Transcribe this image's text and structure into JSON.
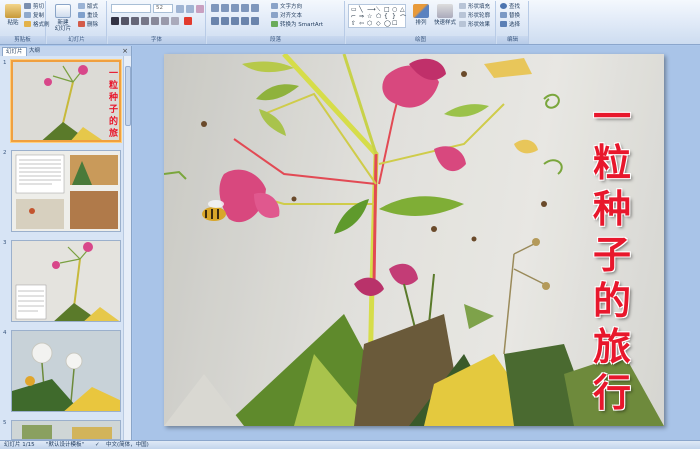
{
  "ribbon": {
    "clipboard": {
      "paste": "粘贴",
      "cut": "剪切",
      "copy": "复制",
      "format_painter": "格式刷",
      "group_label": "剪贴板"
    },
    "slides": {
      "new_slide": "新建\n幻灯片",
      "layout": "版式",
      "reset": "重设",
      "delete": "删除",
      "group_label": "幻灯片"
    },
    "font": {
      "font_size": "52",
      "group_label": "字体"
    },
    "paragraph": {
      "text_direction": "文字方向",
      "align_text": "对齐文本",
      "smartart": "转换为 SmartArt",
      "group_label": "段落"
    },
    "drawing": {
      "arrange": "排列",
      "quick_styles": "快速样式",
      "shape_fill": "形状填充",
      "shape_outline": "形状轮廓",
      "shape_effects": "形状效果",
      "group_label": "绘图"
    },
    "editing": {
      "find": "查找",
      "replace": "替换",
      "select": "选择",
      "group_label": "编辑"
    }
  },
  "panel": {
    "tabs": [
      "幻灯片",
      "大纲"
    ],
    "close_glyph": "×",
    "thumbnails": [
      {
        "num": "1",
        "selected": true
      },
      {
        "num": "2",
        "selected": false
      },
      {
        "num": "3",
        "selected": false
      },
      {
        "num": "4",
        "selected": false
      },
      {
        "num": "5",
        "selected": false
      }
    ]
  },
  "slide": {
    "title_chars": [
      "一",
      "粒",
      "种",
      "子",
      "的",
      "旅",
      "行"
    ],
    "title_color": "#e8172c"
  },
  "status": {
    "slide_info": "幻灯片 1/15",
    "theme": "\"默认设计模板\"",
    "language": "中文(简体，中国)"
  }
}
